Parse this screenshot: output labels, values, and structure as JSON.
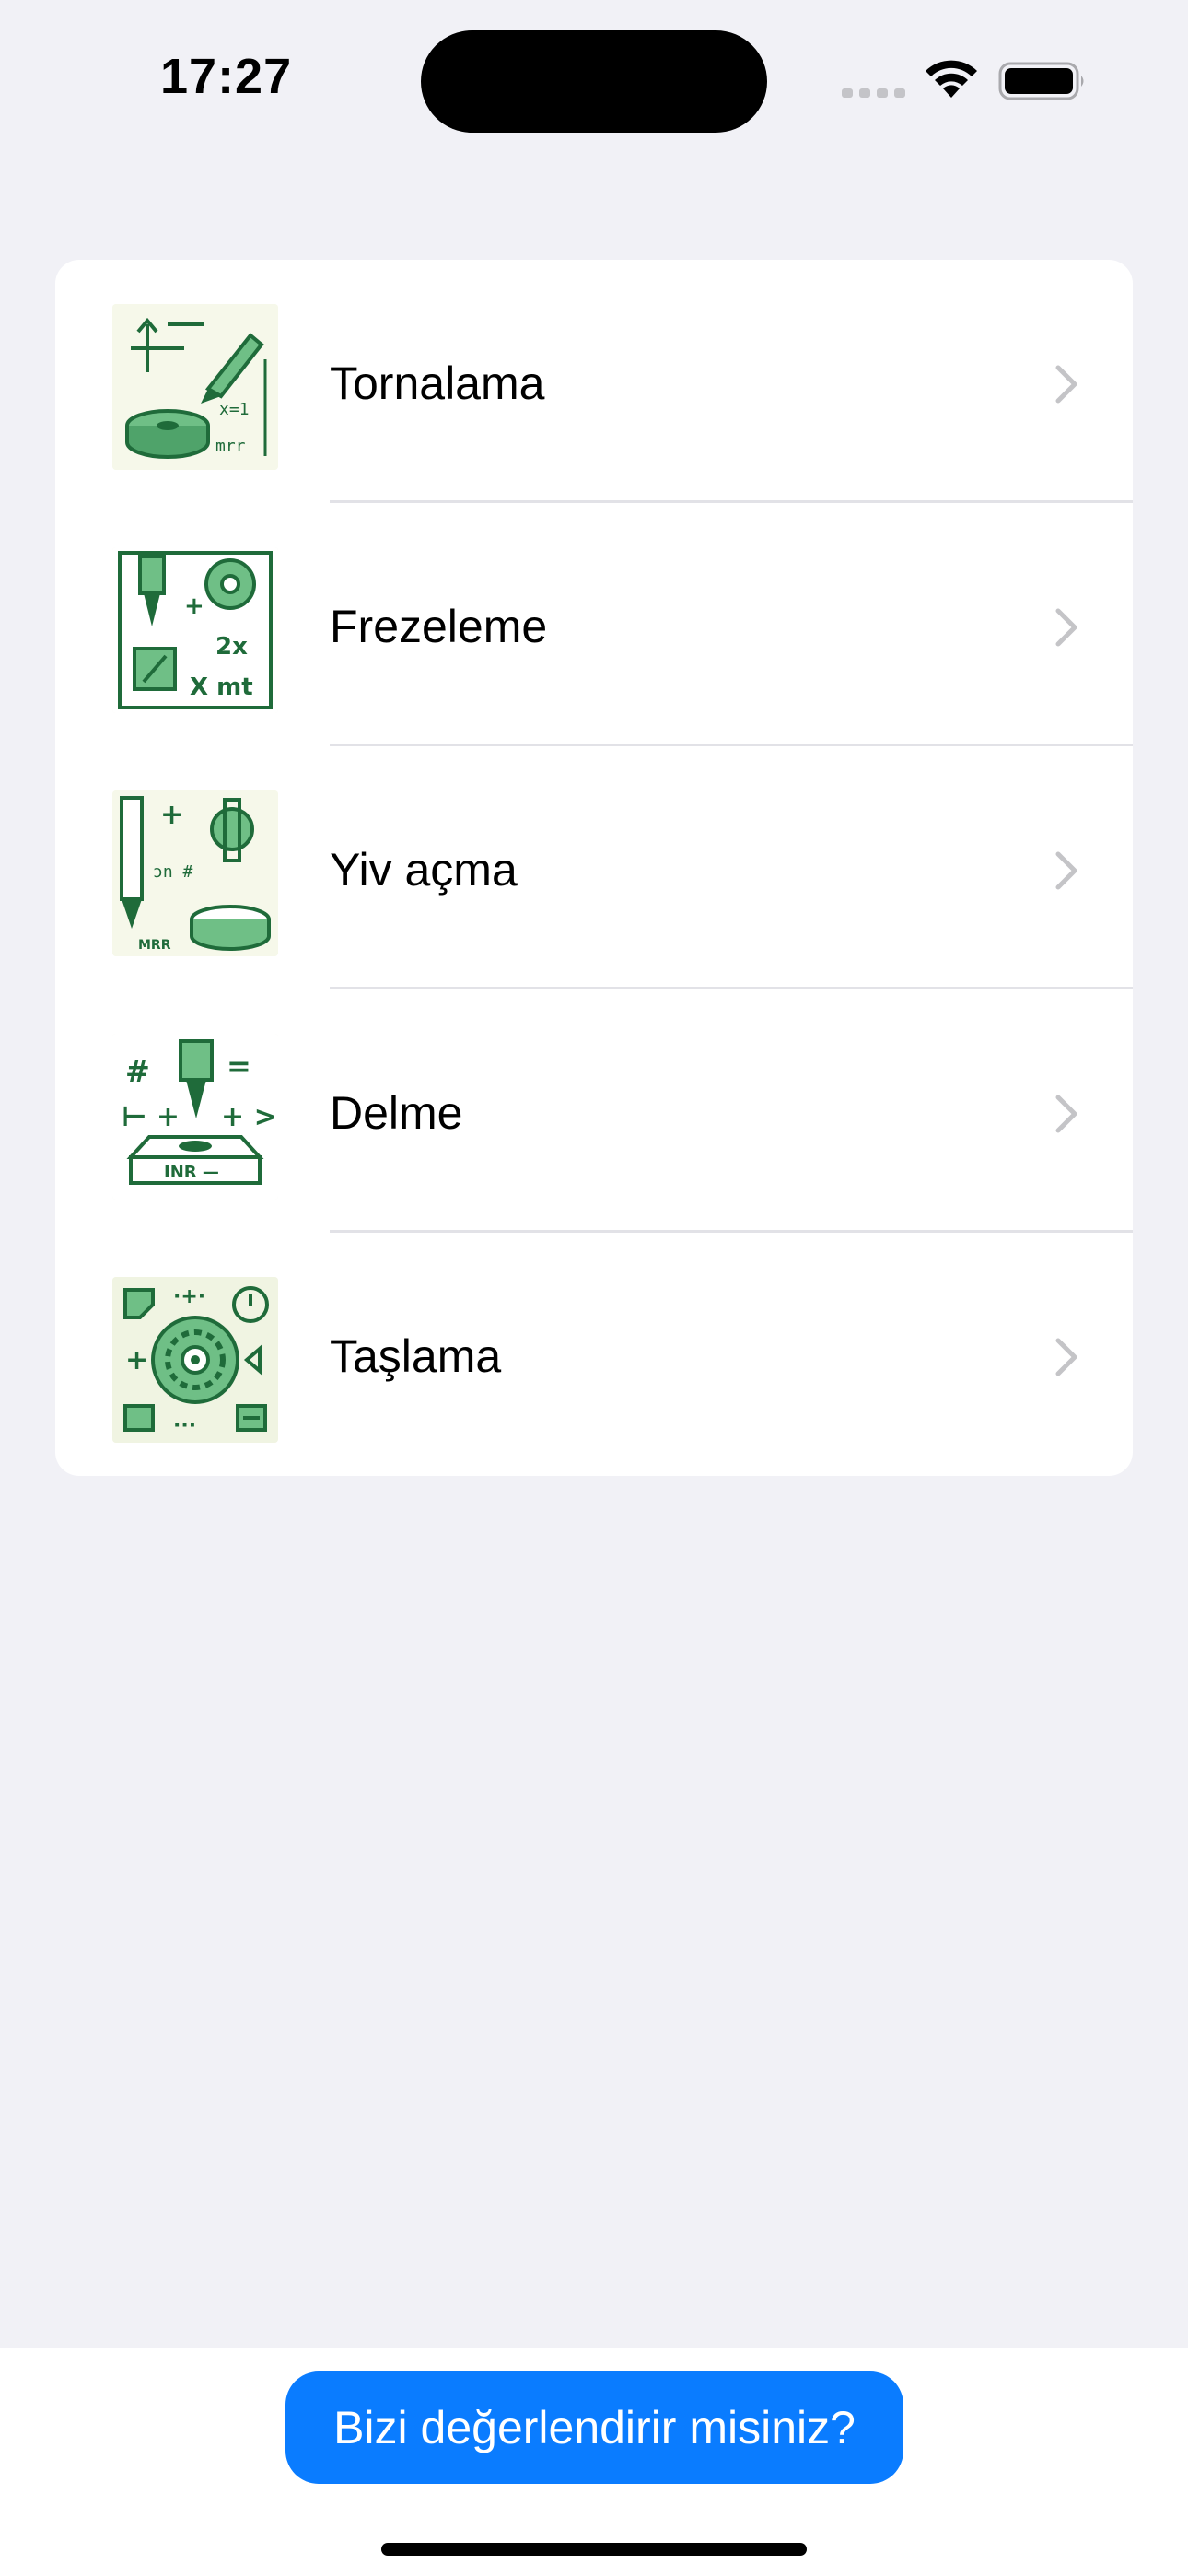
{
  "status_bar": {
    "time": "17:27",
    "icons": [
      "cellular-signal-icon",
      "wifi-icon",
      "battery-icon"
    ]
  },
  "list": {
    "items": [
      {
        "label": "Tornalama",
        "icon": "lathe-turning-illustration"
      },
      {
        "label": "Frezeleme",
        "icon": "milling-illustration"
      },
      {
        "label": "Yiv açma",
        "icon": "grooving-illustration"
      },
      {
        "label": "Delme",
        "icon": "drilling-illustration"
      },
      {
        "label": "Taşlama",
        "icon": "grinding-illustration"
      }
    ]
  },
  "footer": {
    "rate_button_label": "Bizi değerlendirir misiniz?"
  },
  "colors": {
    "background": "#f1f1f6",
    "card": "#ffffff",
    "accent": "#0a7cff",
    "icon_green": "#1f6b3a",
    "icon_light_green": "#6fbf86"
  }
}
